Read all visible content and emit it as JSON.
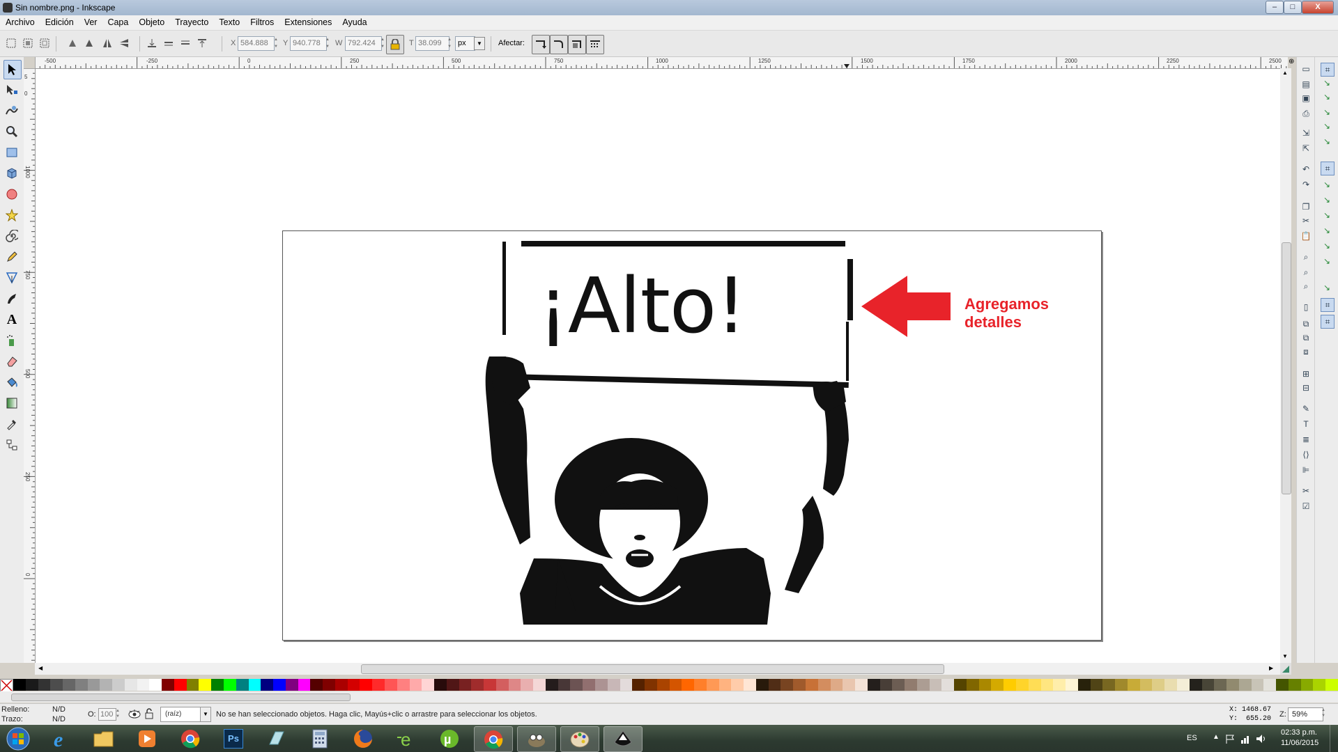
{
  "window": {
    "title": "Sin nombre.png - Inkscape",
    "buttons": [
      "–",
      "□",
      "X"
    ]
  },
  "menu": [
    "Archivo",
    "Edición",
    "Ver",
    "Capa",
    "Objeto",
    "Trayecto",
    "Texto",
    "Filtros",
    "Extensiones",
    "Ayuda"
  ],
  "toolbar": {
    "x_label": "X",
    "x_value": "584.888",
    "y_label": "Y",
    "y_value": "940.778",
    "w_label": "W",
    "w_value": "792.424",
    "h_label": "T",
    "h_value": "38.099",
    "unit": "px",
    "affect_label": "Afectar:"
  },
  "ruler_h": [
    "-500",
    "-250",
    "0",
    "250",
    "500",
    "750",
    "1000",
    "1250",
    "1500",
    "1750",
    "2000",
    "2250",
    "2500"
  ],
  "ruler_v": [
    "5",
    "0",
    "1000",
    "750",
    "500",
    "250",
    "0"
  ],
  "canvas": {
    "sign_text": "¡Alto!",
    "annotation": "Agregamos detalles",
    "annotation_color": "#e8232a"
  },
  "tools": [
    "selector-tool",
    "node-tool",
    "tweak-tool",
    "zoom-tool",
    "rect-tool",
    "3dbox-tool",
    "ellipse-tool",
    "star-tool",
    "spiral-tool",
    "pencil-tool",
    "pen-tool",
    "calligraphy-tool",
    "text-tool",
    "spray-tool",
    "eraser-tool",
    "bucket-tool",
    "gradient-tool",
    "dropper-tool",
    "connector-tool"
  ],
  "status": {
    "fill_label": "Relleno:",
    "fill_value": "N/D",
    "stroke_label": "Trazo:",
    "stroke_value": "N/D",
    "opacity_label": "O:",
    "opacity_value": "100",
    "layer": "(raíz)",
    "message": "No se han seleccionado objetos. Haga clic, Mayús+clic o arrastre para seleccionar los objetos.",
    "cursor_x": "X: 1468.67",
    "cursor_y": "Y:  655.20",
    "zoom_label": "Z:",
    "zoom_value": "59%"
  },
  "taskbar": {
    "lang": "ES",
    "time": "02:33 p.m.",
    "date": "11/06/2015",
    "apps": [
      "start-orb",
      "ie",
      "explorer",
      "media-player",
      "chrome",
      "photoshop",
      "app-6",
      "calculator",
      "firefox",
      "app-9",
      "utorrent",
      "chrome-2",
      "app-12",
      "paint",
      "inkscape"
    ]
  },
  "palette": [
    "#000000",
    "#1a1a1a",
    "#333333",
    "#4d4d4d",
    "#666666",
    "#808080",
    "#999999",
    "#b3b3b3",
    "#cccccc",
    "#e6e6e6",
    "#f2f2f2",
    "#ffffff",
    "#800000",
    "#ff0000",
    "#808000",
    "#ffff00",
    "#008000",
    "#00ff00",
    "#008080",
    "#00ffff",
    "#000080",
    "#0000ff",
    "#800080",
    "#ff00ff",
    "#550000",
    "#7f0000",
    "#aa0000",
    "#d40000",
    "#ff0000",
    "#ff2a2a",
    "#ff5555",
    "#ff8080",
    "#ffaaaa",
    "#ffd5d5",
    "#280b0b",
    "#501616",
    "#782121",
    "#a02c2c",
    "#c83737",
    "#d35f5f",
    "#de8787",
    "#e9afaf",
    "#f4d7d7",
    "#241c1c",
    "#483737",
    "#6c5353",
    "#916f6f",
    "#ac9393",
    "#c8b7b7",
    "#e3dbdb",
    "#552200",
    "#803300",
    "#aa4400",
    "#d45500",
    "#ff6600",
    "#ff7f2a",
    "#ff9955",
    "#ffb380",
    "#ffccaa",
    "#ffe6d5",
    "#281a0b",
    "#502d16",
    "#784421",
    "#a05a2c",
    "#c87137",
    "#d38d5f",
    "#deaa87",
    "#e9c6af",
    "#f4e3d7",
    "#241f1c",
    "#483e37",
    "#6c5d53",
    "#917c6f",
    "#ac9d93",
    "#c8beb7",
    "#e3dedb",
    "#554400",
    "#806600",
    "#aa8800",
    "#d4aa00",
    "#ffcc00",
    "#ffd42a",
    "#ffdd55",
    "#ffe680",
    "#ffeeaa",
    "#fff6d5",
    "#28220b",
    "#504416",
    "#786721",
    "#a0892c",
    "#c8ab37",
    "#d3bc5f",
    "#decd87",
    "#e9ddaf",
    "#f4eed7",
    "#24221c",
    "#484537",
    "#6c6753",
    "#918a6f",
    "#aca793",
    "#c8c4b7",
    "#e3e2db",
    "#445500",
    "#668000",
    "#88aa00",
    "#aad400",
    "#ccff00"
  ]
}
